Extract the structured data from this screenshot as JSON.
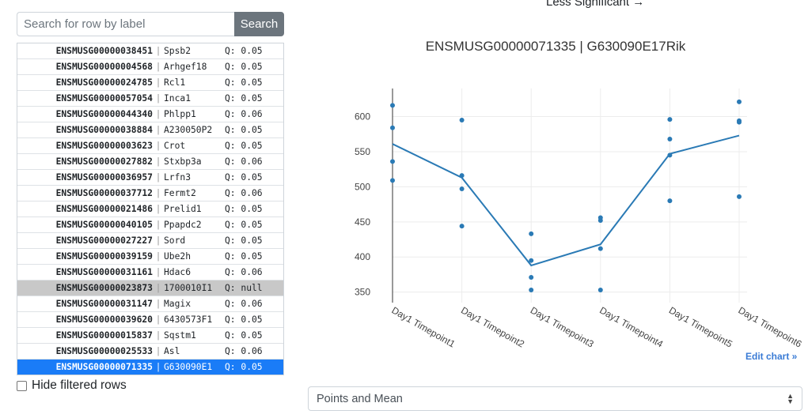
{
  "search": {
    "placeholder": "Search for row by label",
    "button_label": "Search"
  },
  "nav": {
    "less_significant_label": "Less Significant",
    "arrow_glyph": "🡒"
  },
  "genes": [
    {
      "id": "ENSMUSG00000038451",
      "symbol": "Spsb2",
      "q": "Q: 0.05",
      "state": "normal"
    },
    {
      "id": "ENSMUSG00000004568",
      "symbol": "Arhgef18",
      "q": "Q: 0.05",
      "state": "normal"
    },
    {
      "id": "ENSMUSG00000024785",
      "symbol": "Rcl1",
      "q": "Q: 0.05",
      "state": "normal"
    },
    {
      "id": "ENSMUSG00000057054",
      "symbol": "Inca1",
      "q": "Q: 0.05",
      "state": "normal"
    },
    {
      "id": "ENSMUSG00000044340",
      "symbol": "Phlpp1",
      "q": "Q: 0.06",
      "state": "normal"
    },
    {
      "id": "ENSMUSG00000038884",
      "symbol": "A230050P2",
      "q": "Q: 0.05",
      "state": "normal"
    },
    {
      "id": "ENSMUSG00000003623",
      "symbol": "Crot",
      "q": "Q: 0.05",
      "state": "normal"
    },
    {
      "id": "ENSMUSG00000027882",
      "symbol": "Stxbp3a",
      "q": "Q: 0.06",
      "state": "normal"
    },
    {
      "id": "ENSMUSG00000036957",
      "symbol": "Lrfn3",
      "q": "Q: 0.05",
      "state": "normal"
    },
    {
      "id": "ENSMUSG00000037712",
      "symbol": "Fermt2",
      "q": "Q: 0.06",
      "state": "normal"
    },
    {
      "id": "ENSMUSG00000021486",
      "symbol": "Prelid1",
      "q": "Q: 0.05",
      "state": "normal"
    },
    {
      "id": "ENSMUSG00000040105",
      "symbol": "Ppapdc2",
      "q": "Q: 0.05",
      "state": "normal"
    },
    {
      "id": "ENSMUSG00000027227",
      "symbol": "Sord",
      "q": "Q: 0.05",
      "state": "normal"
    },
    {
      "id": "ENSMUSG00000039159",
      "symbol": "Ube2h",
      "q": "Q: 0.05",
      "state": "normal"
    },
    {
      "id": "ENSMUSG00000031161",
      "symbol": "Hdac6",
      "q": "Q: 0.06",
      "state": "normal"
    },
    {
      "id": "ENSMUSG00000023873",
      "symbol": "1700010I1",
      "q": "Q: null",
      "state": "filtered"
    },
    {
      "id": "ENSMUSG00000031147",
      "symbol": "Magix",
      "q": "Q: 0.06",
      "state": "normal"
    },
    {
      "id": "ENSMUSG00000039620",
      "symbol": "6430573F1",
      "q": "Q: 0.05",
      "state": "normal"
    },
    {
      "id": "ENSMUSG00000015837",
      "symbol": "Sqstm1",
      "q": "Q: 0.05",
      "state": "normal"
    },
    {
      "id": "ENSMUSG00000025533",
      "symbol": "Asl",
      "q": "Q: 0.06",
      "state": "normal"
    },
    {
      "id": "ENSMUSG00000071335",
      "symbol": "G630090E1",
      "q": "Q: 0.05",
      "state": "selected"
    }
  ],
  "separator": "|",
  "hide_filtered": {
    "label": "Hide filtered rows",
    "checked": false
  },
  "chart": {
    "title": "ENSMUSG00000071335 | G630090E17Rik",
    "edit_label": "Edit chart »",
    "line_color": "#2a7ab5",
    "point_color": "#2a7ab5"
  },
  "chart_data": {
    "type": "scatter",
    "categories": [
      "Day1 Timepoint1",
      "Day1 Timepoint2",
      "Day1 Timepoint3",
      "Day1 Timepoint4",
      "Day1 Timepoint5",
      "Day1 Timepoint6"
    ],
    "points": [
      [
        616,
        584,
        536,
        509
      ],
      [
        595,
        516,
        497,
        444
      ],
      [
        433,
        395,
        371,
        353
      ],
      [
        456,
        452,
        412,
        353
      ],
      [
        596,
        568,
        545,
        480
      ],
      [
        621,
        594,
        592,
        486
      ]
    ],
    "series": [
      {
        "values": [
          561,
          513,
          388,
          418,
          547,
          573
        ]
      }
    ],
    "yticks": [
      350,
      400,
      450,
      500,
      550,
      600
    ],
    "ylim": [
      335,
      640
    ]
  },
  "display_mode": {
    "value": "Points and Mean"
  }
}
